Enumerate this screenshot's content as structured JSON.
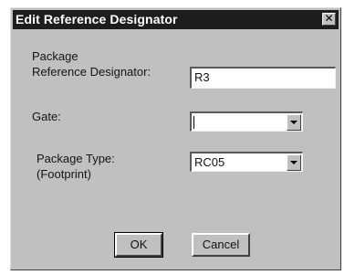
{
  "dialog": {
    "title": "Edit Reference Designator",
    "close_glyph": "✕"
  },
  "fields": {
    "package_ref": {
      "label_line1": "Package",
      "label_line2": "Reference Designator:",
      "value": "R3"
    },
    "gate": {
      "label": "Gate:",
      "value": ""
    },
    "package_type": {
      "label_line1": "Package Type:",
      "label_line2": "(Footprint)",
      "value": "RC05"
    }
  },
  "buttons": {
    "ok": "OK",
    "cancel": "Cancel"
  },
  "icons": {
    "close": "close-icon",
    "dropdown": "chevron-down-icon"
  }
}
